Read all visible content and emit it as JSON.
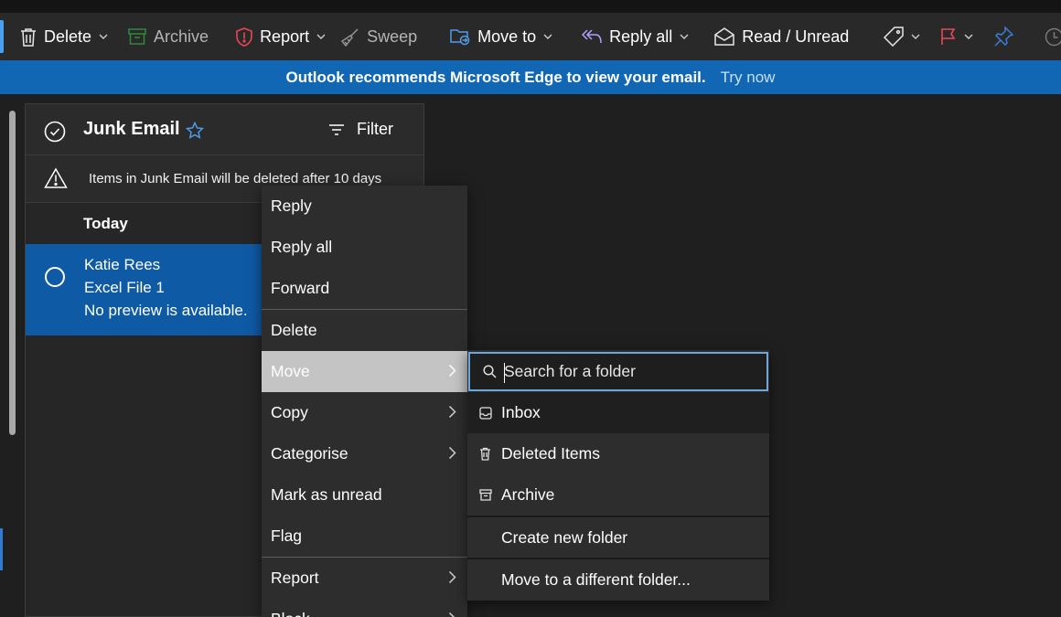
{
  "toolbar": {
    "delete_label": "Delete",
    "archive_label": "Archive",
    "report_label": "Report",
    "sweep_label": "Sweep",
    "move_to_label": "Move to",
    "reply_all_label": "Reply all",
    "read_unread_label": "Read / Unread"
  },
  "banner": {
    "message": "Outlook recommends Microsoft Edge to view your email.",
    "action": "Try now"
  },
  "folder": {
    "title": "Junk Email",
    "filter_label": "Filter",
    "notice": "Items in Junk Email will be deleted after 10 days"
  },
  "messages": {
    "group_label": "Today",
    "items": [
      {
        "sender": "Katie Rees",
        "subject": "Excel File 1",
        "preview": "No preview is available."
      }
    ]
  },
  "context_menu": {
    "items": [
      "Reply",
      "Reply all",
      "Forward",
      "Delete",
      "Move",
      "Copy",
      "Categorise",
      "Mark as unread",
      "Flag",
      "Report",
      "Block"
    ]
  },
  "move_submenu": {
    "search_placeholder": "Search for a folder",
    "folders": [
      "Inbox",
      "Deleted Items",
      "Archive"
    ],
    "create_label": "Create new folder",
    "other_label": "Move to a different folder..."
  },
  "colors": {
    "accent": "#0f6cbd",
    "banner": "#1167b4",
    "selected_row": "#0f5aa5",
    "report_icon": "#e74856",
    "flag_icon": "#e74856",
    "reply_all_icon": "#b4a0ff",
    "pin_icon": "#3a7fd5"
  },
  "icons": [
    "trash-icon",
    "archive-icon",
    "shield-icon",
    "broom-icon",
    "folder-move-icon",
    "reply-all-icon",
    "envelope-open-icon",
    "tag-icon",
    "flag-icon",
    "pin-icon",
    "clock-icon",
    "star-icon",
    "filter-icon",
    "warning-icon",
    "search-icon",
    "inbox-icon"
  ]
}
